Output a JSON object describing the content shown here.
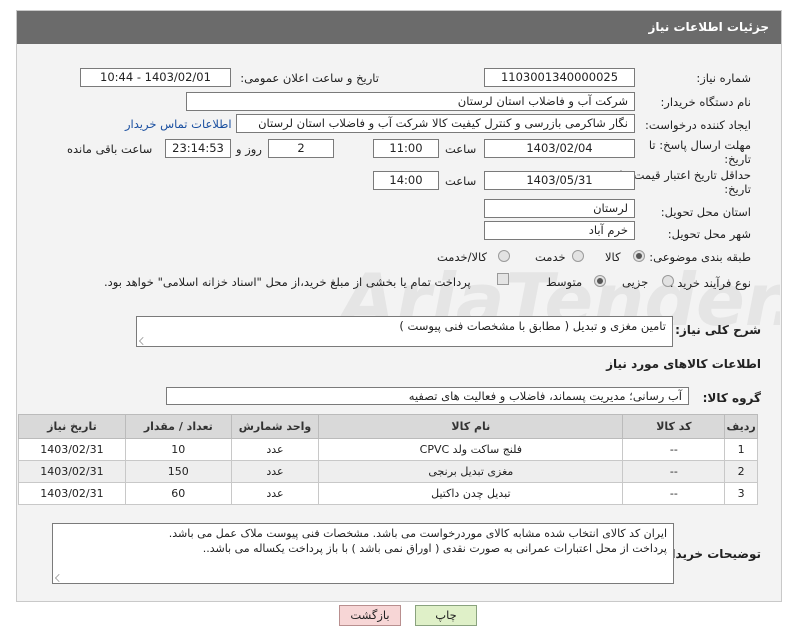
{
  "header": {
    "title": "جزئیات اطلاعات نیاز"
  },
  "fields": {
    "need_number_label": "شماره نیاز:",
    "need_number": "1103001340000025",
    "announce_label": "تاریخ و ساعت اعلان عمومی:",
    "announce_value": "1403/02/01 - 10:44",
    "buyer_org_label": "نام دستگاه خریدار:",
    "buyer_org": "شرکت آب و فاضلاب استان لرستان",
    "creator_label": "ایجاد کننده درخواست:",
    "creator": "نگار شاکرمی بازرسی و کنترل کیفیت کالا شرکت آب و فاضلاب استان لرستان",
    "contact_link": "اطلاعات تماس خریدار",
    "deadline_label_1": "مهلت ارسال پاسخ: تا",
    "deadline_label_2": "تاریخ:",
    "deadline_date": "1403/02/04",
    "time_label": "ساعت",
    "deadline_time": "11:00",
    "days_value": "2",
    "days_label": "روز و",
    "remaining_time": "23:14:53",
    "remaining_label": "ساعت باقی مانده",
    "validity_label_1": "حداقل تاریخ اعتبار قیمت: تا",
    "validity_label_2": "تاریخ:",
    "validity_date": "1403/05/31",
    "validity_time_label": "ساعت",
    "validity_time": "14:00",
    "province_label": "استان محل تحویل:",
    "province": "لرستان",
    "city_label": "شهر محل تحویل:",
    "city": "خرم آباد",
    "category_label": "طبقه بندی موضوعی:",
    "category_options": [
      "کالا",
      "خدمت",
      "کالا/خدمت"
    ],
    "category_selected": "کالا",
    "process_label": "نوع فرآیند خرید :",
    "process_options": [
      "جزیی",
      "متوسط"
    ],
    "process_selected": "متوسط",
    "payment_note": "پرداخت تمام یا بخشی از مبلغ خرید،از محل \"اسناد خزانه اسلامی\" خواهد بود."
  },
  "description": {
    "label": "شرح کلی نیاز:",
    "text": "تامین مغزی و تبدیل ( مطابق با مشخصات فنی پیوست )"
  },
  "goods": {
    "section_title": "اطلاعات کالاهای مورد نیاز",
    "group_label": "گروه کالا:",
    "group_value": "آب رسانی؛ مدیریت پسماند، فاضلاب و فعالیت های تصفیه",
    "columns": [
      "ردیف",
      "کد کالا",
      "نام کالا",
      "واحد شمارش",
      "تعداد / مقدار",
      "تاریخ نیاز"
    ],
    "rows": [
      [
        "1",
        "--",
        "فلنج ساکت ولد CPVC",
        "عدد",
        "10",
        "1403/02/31"
      ],
      [
        "2",
        "--",
        "مغزی تبدیل برنجی",
        "عدد",
        "150",
        "1403/02/31"
      ],
      [
        "3",
        "--",
        "تبدیل چدن داکتیل",
        "عدد",
        "60",
        "1403/02/31"
      ]
    ]
  },
  "buyer_notes": {
    "label": "توضیحات خریدار:",
    "line1": "ایران کد کالای انتخاب شده مشابه کالای موردرخواست می باشد. مشخصات فنی پیوست ملاک عمل می باشد.",
    "line2": "پرداخت از محل اعتبارات عمرانی به صورت نقدی ( اوراق نمی باشد ) با  باز پرداخت یکساله می باشد.."
  },
  "buttons": {
    "print": "چاپ",
    "back": "بازگشت"
  },
  "colors": {
    "header_bg": "#6b6b6b",
    "print_btn": "#dff0c8",
    "back_btn": "#f7d6d6"
  }
}
